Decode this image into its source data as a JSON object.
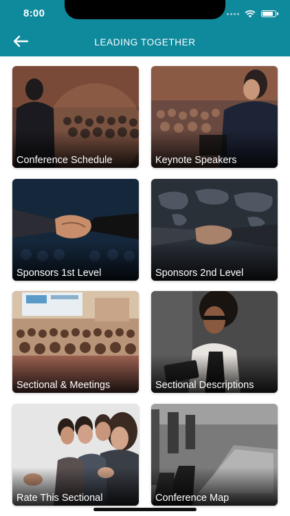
{
  "status_bar": {
    "time": "8:00",
    "wifi_icon": "wifi-icon",
    "battery_icon": "battery-icon"
  },
  "header": {
    "title": "LEADING TOGETHER",
    "back_icon": "arrow-left-icon",
    "color": "#0f8a9d"
  },
  "tiles": [
    {
      "label": "Conference Schedule",
      "icon": "speaker-audience-photo"
    },
    {
      "label": "Keynote Speakers",
      "icon": "keynote-speaker-photo"
    },
    {
      "label": "Sponsors 1st Level",
      "icon": "handshake-photo"
    },
    {
      "label": "Sponsors 2nd Level",
      "icon": "handshake-world-map-photo"
    },
    {
      "label": "Sectional & Meetings",
      "icon": "seminar-room-photo"
    },
    {
      "label": "Sectional Descriptions",
      "icon": "woman-with-tablet-photo"
    },
    {
      "label": "Rate This Sectional",
      "icon": "applauding-audience-photo"
    },
    {
      "label": "Conference Map",
      "icon": "empty-meeting-room-photo"
    }
  ]
}
